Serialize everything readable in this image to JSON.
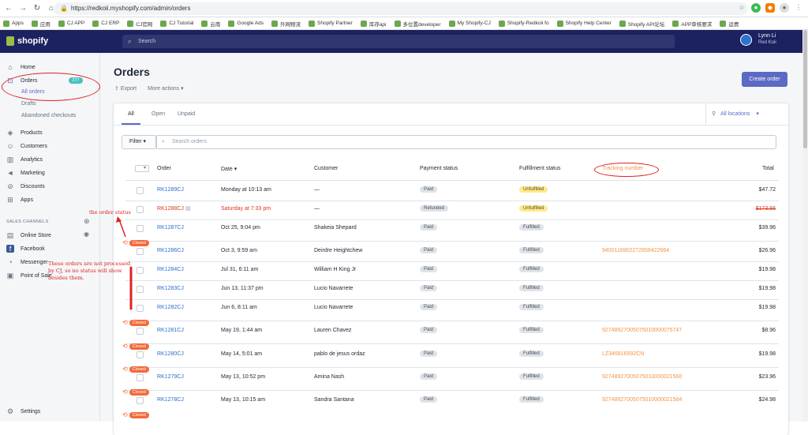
{
  "browser": {
    "url": "https://redkoii.myshopify.com/admin/orders"
  },
  "bookmarks": [
    "Apps",
    "应用",
    "CJ APP",
    "CJ ERP",
    "CJ官网",
    "CJ Tutorial",
    "云南",
    "Google Ads",
    "外网物流",
    "Shopify Partner",
    "库存api",
    "多位置developer",
    "My Shopify-CJ",
    "Shopify-Redkoii fo",
    "Shopify Help Center",
    "Shopify API论坛",
    "APP审核要求",
    "运费"
  ],
  "header": {
    "logo": "shopify",
    "search_placeholder": "Search",
    "user_name": "Lynn Li",
    "store_name": "Red Koii"
  },
  "sidebar": {
    "home": "Home",
    "orders": "Orders",
    "orders_count": "277",
    "all_orders": "All orders",
    "drafts": "Drafts",
    "abandoned": "Abandoned checkouts",
    "products": "Products",
    "customers": "Customers",
    "analytics": "Analytics",
    "marketing": "Marketing",
    "discounts": "Discounts",
    "apps": "Apps",
    "sales_channels": "SALES CHANNELS",
    "online_store": "Online Store",
    "facebook": "Facebook",
    "messenger": "Messenger",
    "pos": "Point of Sale",
    "settings": "Settings"
  },
  "page": {
    "title": "Orders",
    "export": "Export",
    "more_actions": "More actions",
    "create_order": "Create order"
  },
  "tabs": {
    "all": "All",
    "open": "Open",
    "unpaid": "Unpaid",
    "locations": "All locations"
  },
  "filter": {
    "label": "Filter",
    "placeholder": "Search orders"
  },
  "columns": {
    "order": "Order",
    "date": "Date",
    "customer": "Customer",
    "payment": "Payment status",
    "fulfillment": "Fulfillment status",
    "tracking": "Tracking number",
    "total": "Total"
  },
  "closed_label": "Closed",
  "rows": [
    {
      "order": "RK1289CJ",
      "date": "Monday at 10:13 am",
      "customer": "—",
      "payment": "Paid",
      "fulfillment": "Unfulfilled",
      "tracking": "",
      "total": "$47.72"
    },
    {
      "order": "RK1288CJ",
      "date": "Saturday at 7:33 pm",
      "customer": "—",
      "payment": "Refunded",
      "fulfillment": "Unfulfilled",
      "tracking": "",
      "total": "$173.56"
    },
    {
      "order": "RK1287CJ",
      "date": "Oct 25, 9:04 pm",
      "customer": "Shakeia Shepard",
      "payment": "Paid",
      "fulfillment": "Fulfilled",
      "tracking": "",
      "total": "$39.96"
    },
    {
      "order": "RK1286CJ",
      "date": "Oct 3, 9:59 am",
      "customer": "Deirdre Heightchew",
      "payment": "Paid",
      "fulfillment": "Fulfilled",
      "tracking": "9400116902272658422664",
      "total": "$26.96"
    },
    {
      "order": "RK1284CJ",
      "date": "Jul 31, 6:11 am",
      "customer": "William H King Jr",
      "payment": "Paid",
      "fulfillment": "Fulfilled",
      "tracking": "",
      "total": "$19.98"
    },
    {
      "order": "RK1283CJ",
      "date": "Jun 13, 11:37 pm",
      "customer": "Lucio Navarrete",
      "payment": "Paid",
      "fulfillment": "Fulfilled",
      "tracking": "",
      "total": "$19.98"
    },
    {
      "order": "RK1282CJ",
      "date": "Jun 6, 8:11 am",
      "customer": "Lucio Navarrete",
      "payment": "Paid",
      "fulfillment": "Fulfilled",
      "tracking": "",
      "total": "$19.98"
    },
    {
      "order": "RK1281CJ",
      "date": "May 19, 1:44 am",
      "customer": "Lauren Chavez",
      "payment": "Paid",
      "fulfillment": "Fulfilled",
      "tracking": "9274892700507501000007574​7",
      "total": "$8.96"
    },
    {
      "order": "RK1280CJ",
      "date": "May 14, 5:01 am",
      "customer": "pablo de jesus ordaz",
      "payment": "Paid",
      "fulfillment": "Fulfilled",
      "tracking": "LZ346816592CN",
      "total": "$19.98"
    },
    {
      "order": "RK1279CJ",
      "date": "May 13, 10:52 pm",
      "customer": "Amina Nash",
      "payment": "Paid",
      "fulfillment": "Fulfilled",
      "tracking": "92748927005075010000021560",
      "total": "$23.96"
    },
    {
      "order": "RK1278CJ",
      "date": "May 13, 10:15 am",
      "customer": "Sandra Santana",
      "payment": "Paid",
      "fulfillment": "Fulfilled",
      "tracking": "92748927005075010000021584",
      "total": "$24.98"
    }
  ],
  "annotations": {
    "order_status": "the order status",
    "not_processed": "These orders are not processed by CJ, so no status will show besides them."
  },
  "colors": {
    "accent": "#5c6ac4",
    "annotation": "#e02020",
    "closed": "#f4693a",
    "tracking": "#f49342"
  }
}
